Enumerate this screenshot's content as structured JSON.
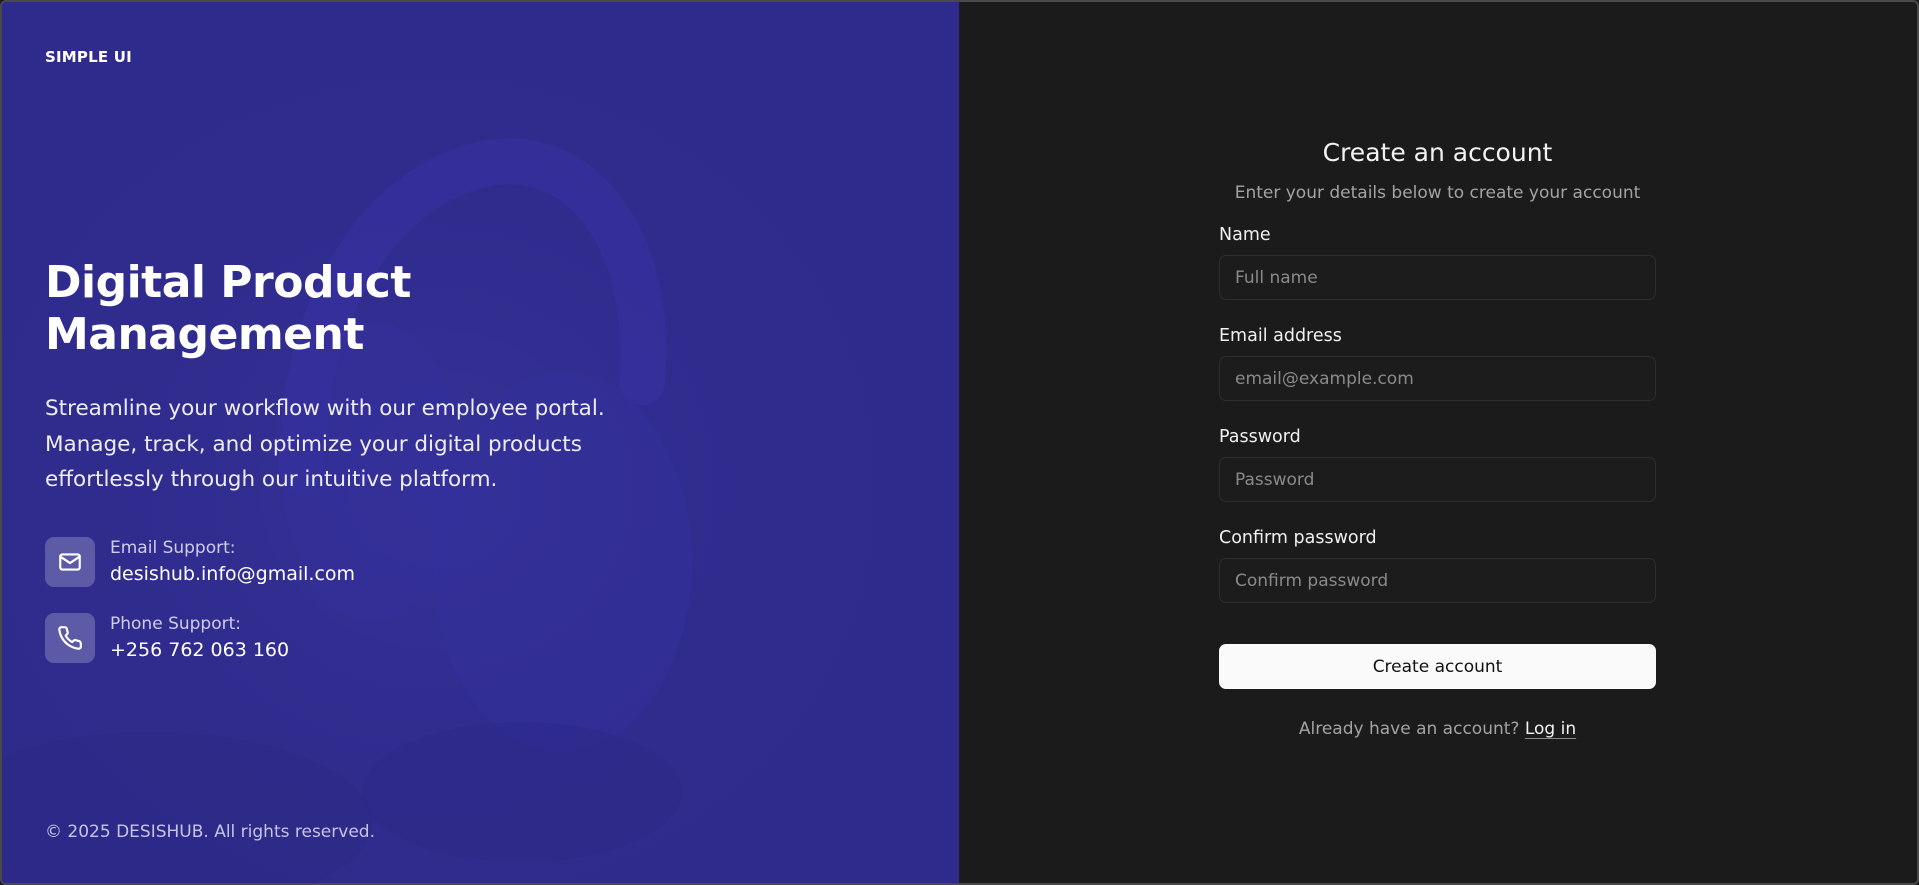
{
  "left_panel": {
    "brand": "SIMPLE UI",
    "hero": {
      "title_lines": [
        "Digital Product",
        "Management"
      ],
      "description_lines": [
        "Streamline your workflow with our employee portal.",
        "Manage, track, and optimize your digital products",
        "effortlessly through our intuitive platform."
      ]
    },
    "support": [
      {
        "icon": "mail-icon",
        "label": "Email Support:",
        "value": "desishub.info@gmail.com"
      },
      {
        "icon": "phone-icon",
        "label": "Phone Support:",
        "value": "+256 762 063 160"
      }
    ],
    "copyright": "© 2025 DESISHUB. All rights reserved.",
    "colors": {
      "background": "#2f2b8c",
      "icon_tile": "rgba(255,255,255,0.22)"
    }
  },
  "form": {
    "title": "Create an account",
    "subtitle": "Enter your details below to create your account",
    "fields": [
      {
        "label": "Name",
        "placeholder": "Full name",
        "value": ""
      },
      {
        "label": "Email address",
        "placeholder": "email@example.com",
        "value": ""
      },
      {
        "label": "Password",
        "placeholder": "Password",
        "value": ""
      },
      {
        "label": "Confirm password",
        "placeholder": "Confirm password",
        "value": ""
      }
    ],
    "submit_label": "Create account",
    "login_prompt": "Already have an account?",
    "login_link": "Log in",
    "colors": {
      "background": "#1b1b1b",
      "button": "#fafafa",
      "button_text": "#111111"
    }
  }
}
